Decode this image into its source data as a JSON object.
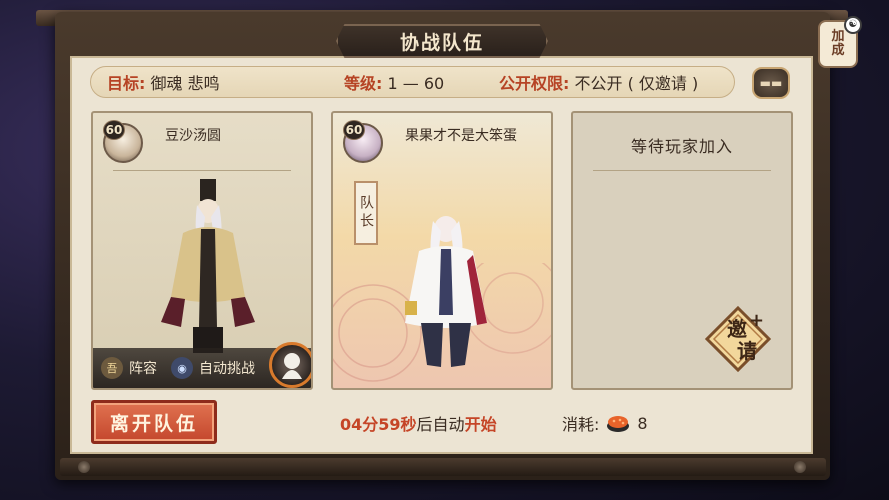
{
  "title": "协战队伍",
  "buff_badge": {
    "label_line1": "加",
    "label_line2": "成"
  },
  "info": {
    "target_label": "目标:",
    "target_value": "御魂 悲鸣",
    "level_label": "等级:",
    "level_value": "1 — 60",
    "permission_label": "公开权限:",
    "permission_value": "不公开 ( 仅邀请 )"
  },
  "members": [
    {
      "level": "60",
      "name": "豆沙汤圆",
      "lineup_label": "阵容",
      "auto_label": "自动挑战"
    },
    {
      "level": "60",
      "name": "果果才不是大笨蛋",
      "captain_label": "队长"
    },
    {
      "waiting_label": "等待玩家加入"
    }
  ],
  "invite_label_1": "邀",
  "invite_label_2": "请",
  "leave_button": "离开队伍",
  "countdown": {
    "time": "04分59秒",
    "mid": "后自动",
    "action": "开始"
  },
  "cost": {
    "label": "消耗:",
    "value": "8"
  },
  "colors": {
    "accent_red": "#c54527",
    "panel_bg": "#ece4d3",
    "frame": "#3a2c21"
  }
}
